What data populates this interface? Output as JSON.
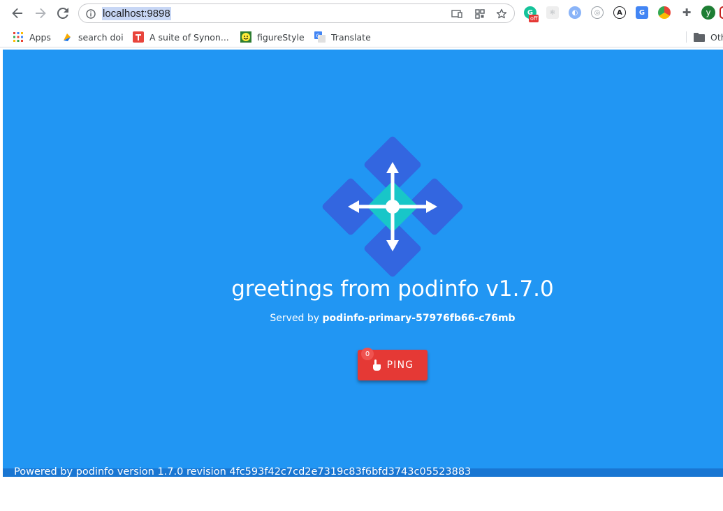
{
  "browser": {
    "url": "localhost:9898",
    "extension_badge": "off",
    "profile_initial": "y"
  },
  "bookmarks": [
    {
      "label": "Apps",
      "icon": "apps-grid-icon"
    },
    {
      "label": "search doi",
      "icon": "search-doi-icon"
    },
    {
      "label": "A suite of Synon...",
      "icon": "synonym-suite-icon"
    },
    {
      "label": "figureStyle",
      "icon": "smiley-icon"
    },
    {
      "label": "Translate",
      "icon": "google-translate-icon"
    },
    {
      "label": "Oth",
      "icon": "folder-icon"
    }
  ],
  "page": {
    "headline": "greetings from podinfo v1.7.0",
    "served_prefix": "Served by",
    "served_host": "podinfo-primary-57976fb66-c76mb",
    "ping_label": "PING",
    "ping_count": "0",
    "footer": "Powered by podinfo version 1.7.0 revision 4fc593f42c7cd2e7319c83f6bfd3743c05523883"
  },
  "colors": {
    "background": "#2196f3",
    "footer_bar": "#1976d2",
    "ping_button": "#e53935",
    "logo_diamond": "#3366e0",
    "logo_center": "#18c6c8"
  }
}
